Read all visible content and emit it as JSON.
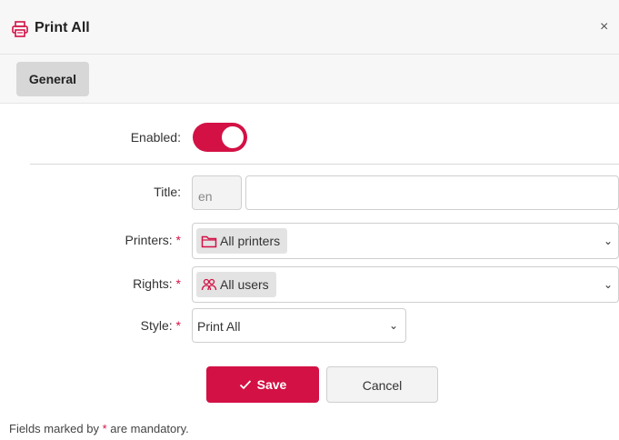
{
  "dialog": {
    "title": "Print All",
    "close_glyph": "×",
    "icon": "printer-icon",
    "accent_color": "#d31145"
  },
  "tabs": [
    {
      "label": "General",
      "active": true
    }
  ],
  "form": {
    "enabled": {
      "label": "Enabled:",
      "value": true
    },
    "title": {
      "label": "Title:",
      "lang": "en",
      "value": ""
    },
    "printers": {
      "label": "Printers:",
      "required_mark": "*",
      "chip": "All printers",
      "chip_icon": "folder-icon"
    },
    "rights": {
      "label": "Rights:",
      "required_mark": "*",
      "chip": "All users",
      "chip_icon": "users-icon"
    },
    "style": {
      "label": "Style:",
      "required_mark": "*",
      "value": "Print All"
    }
  },
  "buttons": {
    "save": "Save",
    "cancel": "Cancel"
  },
  "footer": {
    "pre": "Fields marked by ",
    "mark": "*",
    "post": " are mandatory."
  }
}
